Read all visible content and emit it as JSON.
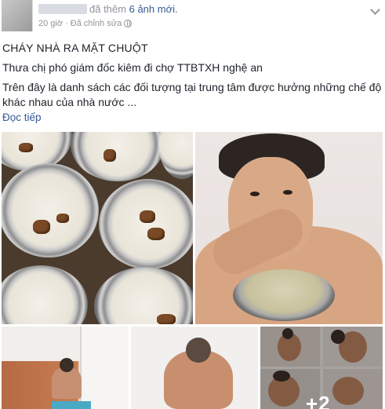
{
  "post": {
    "action_prefix": "đã thêm",
    "action_link": "6 ảnh mới.",
    "time": "20 giờ",
    "separator": "·",
    "edited": "Đã chỉnh sửa",
    "title": "CHÁY NHÀ RA MẶT CHUỘT",
    "line1": "Thưa chị phó giám đốc kiêm đi chợ TTBTXH nghệ an",
    "line2": "Trên đây là danh sách các đối tượng tại trung tâm được hưởng những chế độ khác nhau của nhà nước ...",
    "see_more": "Đọc tiếp"
  },
  "photos": {
    "more_count": "+2"
  },
  "icons": {
    "privacy": "globe-icon",
    "menu": "chevron-down-icon"
  },
  "colors": {
    "link": "#365899",
    "meta": "#90949c",
    "text": "#1d2129"
  }
}
